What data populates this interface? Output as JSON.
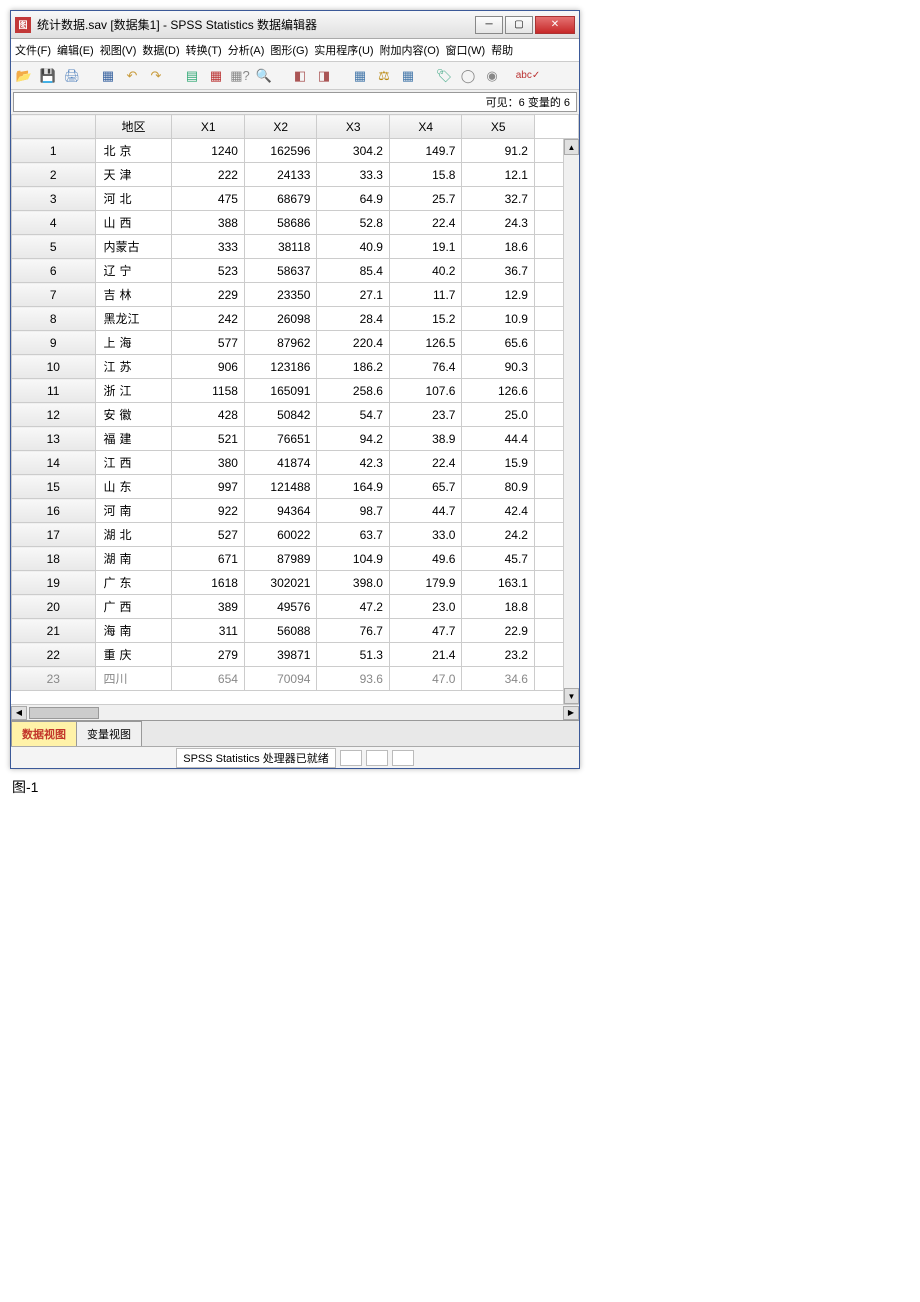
{
  "window": {
    "title": "统计数据.sav [数据集1] - SPSS Statistics 数据编辑器",
    "icon_text": "图"
  },
  "menus": [
    "文件(F)",
    "编辑(E)",
    "视图(V)",
    "数据(D)",
    "转换(T)",
    "分析(A)",
    "图形(G)",
    "实用程序(U)",
    "附加内容(O)",
    "窗口(W)",
    "帮助"
  ],
  "visible_info": "可见：6 变量的 6",
  "columns": [
    "",
    "地区",
    "X1",
    "X2",
    "X3",
    "X4",
    "X5",
    ""
  ],
  "rows": [
    {
      "n": "1",
      "region": "北京",
      "sp": true,
      "x1": "1240",
      "x2": "162596",
      "x3": "304.2",
      "x4": "149.7",
      "x5": "91.2"
    },
    {
      "n": "2",
      "region": "天津",
      "sp": true,
      "x1": "222",
      "x2": "24133",
      "x3": "33.3",
      "x4": "15.8",
      "x5": "12.1"
    },
    {
      "n": "3",
      "region": "河北",
      "sp": true,
      "x1": "475",
      "x2": "68679",
      "x3": "64.9",
      "x4": "25.7",
      "x5": "32.7"
    },
    {
      "n": "4",
      "region": "山西",
      "sp": true,
      "x1": "388",
      "x2": "58686",
      "x3": "52.8",
      "x4": "22.4",
      "x5": "24.3"
    },
    {
      "n": "5",
      "region": "内蒙古",
      "sp": false,
      "x1": "333",
      "x2": "38118",
      "x3": "40.9",
      "x4": "19.1",
      "x5": "18.6"
    },
    {
      "n": "6",
      "region": "辽宁",
      "sp": true,
      "x1": "523",
      "x2": "58637",
      "x3": "85.4",
      "x4": "40.2",
      "x5": "36.7"
    },
    {
      "n": "7",
      "region": "吉林",
      "sp": true,
      "x1": "229",
      "x2": "23350",
      "x3": "27.1",
      "x4": "11.7",
      "x5": "12.9"
    },
    {
      "n": "8",
      "region": "黑龙江",
      "sp": false,
      "x1": "242",
      "x2": "26098",
      "x3": "28.4",
      "x4": "15.2",
      "x5": "10.9"
    },
    {
      "n": "9",
      "region": "上海",
      "sp": true,
      "x1": "577",
      "x2": "87962",
      "x3": "220.4",
      "x4": "126.5",
      "x5": "65.6"
    },
    {
      "n": "10",
      "region": "江苏",
      "sp": true,
      "x1": "906",
      "x2": "123186",
      "x3": "186.2",
      "x4": "76.4",
      "x5": "90.3"
    },
    {
      "n": "11",
      "region": "浙江",
      "sp": true,
      "x1": "1158",
      "x2": "165091",
      "x3": "258.6",
      "x4": "107.6",
      "x5": "126.6"
    },
    {
      "n": "12",
      "region": "安徽",
      "sp": true,
      "x1": "428",
      "x2": "50842",
      "x3": "54.7",
      "x4": "23.7",
      "x5": "25.0"
    },
    {
      "n": "13",
      "region": "福建",
      "sp": true,
      "x1": "521",
      "x2": "76651",
      "x3": "94.2",
      "x4": "38.9",
      "x5": "44.4"
    },
    {
      "n": "14",
      "region": "江西",
      "sp": true,
      "x1": "380",
      "x2": "41874",
      "x3": "42.3",
      "x4": "22.4",
      "x5": "15.9"
    },
    {
      "n": "15",
      "region": "山东",
      "sp": true,
      "x1": "997",
      "x2": "121488",
      "x3": "164.9",
      "x4": "65.7",
      "x5": "80.9"
    },
    {
      "n": "16",
      "region": "河南",
      "sp": true,
      "x1": "922",
      "x2": "94364",
      "x3": "98.7",
      "x4": "44.7",
      "x5": "42.4"
    },
    {
      "n": "17",
      "region": "湖北",
      "sp": true,
      "x1": "527",
      "x2": "60022",
      "x3": "63.7",
      "x4": "33.0",
      "x5": "24.2"
    },
    {
      "n": "18",
      "region": "湖南",
      "sp": true,
      "x1": "671",
      "x2": "87989",
      "x3": "104.9",
      "x4": "49.6",
      "x5": "45.7"
    },
    {
      "n": "19",
      "region": "广东",
      "sp": true,
      "x1": "1618",
      "x2": "302021",
      "x3": "398.0",
      "x4": "179.9",
      "x5": "163.1"
    },
    {
      "n": "20",
      "region": "广西",
      "sp": true,
      "x1": "389",
      "x2": "49576",
      "x3": "47.2",
      "x4": "23.0",
      "x5": "18.8"
    },
    {
      "n": "21",
      "region": "海南",
      "sp": true,
      "x1": "311",
      "x2": "56088",
      "x3": "76.7",
      "x4": "47.7",
      "x5": "22.9"
    },
    {
      "n": "22",
      "region": "重庆",
      "sp": true,
      "x1": "279",
      "x2": "39871",
      "x3": "51.3",
      "x4": "21.4",
      "x5": "23.2"
    }
  ],
  "partial_row": {
    "n": "23",
    "region": "四川",
    "x1": "654",
    "x2": "70094",
    "x3": "93.6",
    "x4": "47.0",
    "x5": "34.6"
  },
  "tabs": {
    "data": "数据视图",
    "variable": "变量视图"
  },
  "status": "SPSS Statistics 处理器已就绪",
  "caption": "图-1"
}
